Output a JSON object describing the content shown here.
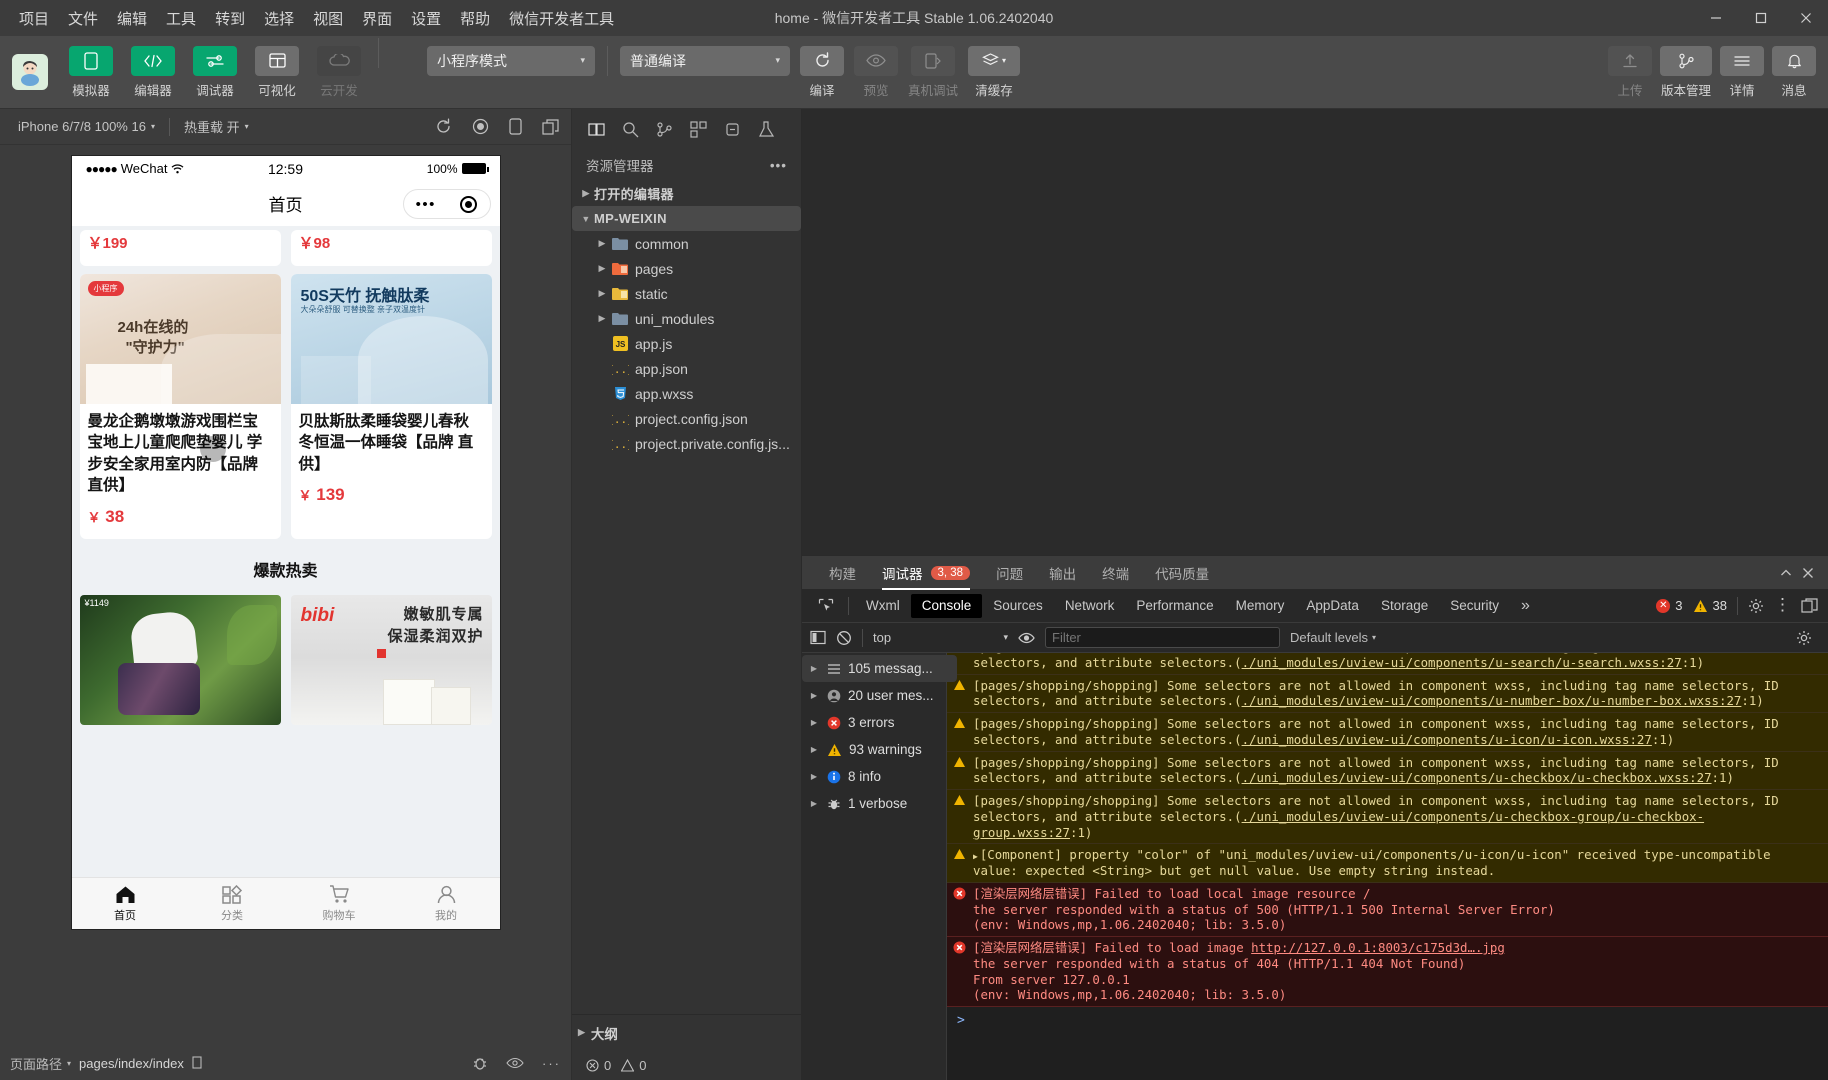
{
  "window": {
    "title": "home - 微信开发者工具 Stable 1.06.2402040",
    "controls": [
      "minimize",
      "maximize",
      "close"
    ]
  },
  "menubar": {
    "items": [
      "项目",
      "文件",
      "编辑",
      "工具",
      "转到",
      "选择",
      "视图",
      "界面",
      "设置",
      "帮助",
      "微信开发者工具"
    ]
  },
  "toolbar": {
    "avatar_icon": "user-avatar",
    "left_buttons": [
      {
        "label": "模拟器",
        "icon": "phone-icon",
        "style": "green"
      },
      {
        "label": "编辑器",
        "icon": "code-icon",
        "style": "green"
      },
      {
        "label": "调试器",
        "icon": "sliders-icon",
        "style": "green"
      },
      {
        "label": "可视化",
        "icon": "layout-icon",
        "style": "gray"
      },
      {
        "label": "云开发",
        "icon": "cloud-icon",
        "style": "dim"
      }
    ],
    "mode_select": {
      "value": "小程序模式",
      "caret": "▾"
    },
    "compile_select": {
      "value": "普通编译",
      "caret": "▾"
    },
    "mid_buttons": [
      {
        "label": "编译",
        "icon": "refresh-icon",
        "style": "gray"
      },
      {
        "label": "预览",
        "icon": "eye-icon",
        "style": "dim"
      },
      {
        "label": "真机调试",
        "icon": "phone-debug-icon",
        "style": "dim"
      },
      {
        "label": "清缓存",
        "icon": "layers-icon",
        "style": "gray",
        "caret": "▾"
      }
    ],
    "right_buttons": [
      {
        "label": "上传",
        "icon": "upload-icon",
        "style": "dim"
      },
      {
        "label": "版本管理",
        "icon": "branch-icon",
        "style": "gray"
      },
      {
        "label": "详情",
        "icon": "menu-icon",
        "style": "gray"
      },
      {
        "label": "消息",
        "icon": "bell-icon",
        "style": "gray"
      }
    ]
  },
  "simulator": {
    "device_select": "iPhone 6/7/8 100% 16",
    "hotreload_select": "热重载 开",
    "icons": [
      "refresh-icon",
      "record-icon",
      "rotate-device-icon",
      "detach-window-icon"
    ],
    "phone": {
      "status": {
        "carrier": "WeChat",
        "dots": "●●●●●",
        "wifi": "wifi-icon",
        "time": "12:59",
        "battery_text": "100%"
      },
      "nav_title": "首页",
      "capsule": {
        "more": "•••",
        "target": "target-icon"
      },
      "products": [
        {
          "title": "曼龙企鹅墩墩游戏围栏宝宝地上儿童爬爬垫婴儿 学步安全家用室内防【品牌直供】",
          "price": "38",
          "currency": "￥"
        },
        {
          "title": "贝肽斯肽柔睡袋婴儿春秋冬恒温一体睡袋【品牌 直供】",
          "price": "139",
          "currency": "￥"
        }
      ],
      "section_title": "爆款热卖",
      "banners": [
        {
          "name": "fashion-banner",
          "text": "¥1149"
        },
        {
          "name": "bibi-banner",
          "brand": "bibi",
          "line1": "嫩敏肌专属",
          "line2": "保湿柔润双护"
        }
      ],
      "tabbar": [
        {
          "label": "首页",
          "icon": "home-icon",
          "active": true
        },
        {
          "label": "分类",
          "icon": "grid-icon",
          "active": false
        },
        {
          "label": "购物车",
          "icon": "cart-icon",
          "active": false
        },
        {
          "label": "我的",
          "icon": "person-icon",
          "active": false
        }
      ]
    },
    "footer": {
      "path_label": "页面路径",
      "path_value": "pages/index/index",
      "copy_icon": "copy-icon",
      "right_icons": [
        "bug-icon",
        "eye-icon",
        "more-icon"
      ]
    }
  },
  "explorer": {
    "tab_icons": [
      "files-icon",
      "search-icon",
      "source-control-icon",
      "extensions-icon",
      "debug-icon",
      "test-icon"
    ],
    "header": "资源管理器",
    "header_more": "•••",
    "sections": [
      {
        "label": "打开的编辑器",
        "expanded": false
      },
      {
        "label": "MP-WEIXIN",
        "expanded": true
      }
    ],
    "tree": [
      {
        "label": "common",
        "type": "folder",
        "icon": "folder-blue"
      },
      {
        "label": "pages",
        "type": "folder",
        "icon": "folder-orange"
      },
      {
        "label": "static",
        "type": "folder",
        "icon": "folder-yellow"
      },
      {
        "label": "uni_modules",
        "type": "folder",
        "icon": "folder-blue"
      },
      {
        "label": "app.js",
        "type": "file",
        "icon": "js-icon"
      },
      {
        "label": "app.json",
        "type": "file",
        "icon": "json-icon"
      },
      {
        "label": "app.wxss",
        "type": "file",
        "icon": "css-icon"
      },
      {
        "label": "project.config.json",
        "type": "file",
        "icon": "json-icon"
      },
      {
        "label": "project.private.config.js...",
        "type": "file",
        "icon": "json-icon"
      }
    ],
    "outline": "大纲",
    "status": {
      "errors": "0",
      "warnings": "0"
    }
  },
  "devtools": {
    "panel_tabs": [
      {
        "label": "构建",
        "active": false
      },
      {
        "label": "调试器",
        "active": true,
        "badge": "3, 38"
      },
      {
        "label": "问题",
        "active": false
      },
      {
        "label": "输出",
        "active": false
      },
      {
        "label": "终端",
        "active": false
      },
      {
        "label": "代码质量",
        "active": false
      }
    ],
    "panel_actions": [
      "collapse-icon",
      "close-icon"
    ],
    "inspector_icon": "inspect-element-icon",
    "tabs": [
      {
        "label": "Wxml",
        "active": false
      },
      {
        "label": "Console",
        "active": true
      },
      {
        "label": "Sources",
        "active": false
      },
      {
        "label": "Network",
        "active": false
      },
      {
        "label": "Performance",
        "active": false
      },
      {
        "label": "Memory",
        "active": false
      },
      {
        "label": "AppData",
        "active": false
      },
      {
        "label": "Storage",
        "active": false
      },
      {
        "label": "Security",
        "active": false
      }
    ],
    "overflow": "»",
    "counts": {
      "errors": "3",
      "warnings": "38"
    },
    "tab_actions": [
      "settings-gear-icon",
      "more-vertical-icon",
      "dock-panel-icon"
    ],
    "console_bar": {
      "sidebar_toggle_icon": "toggle-sidebar-icon",
      "clear_icon": "clear-console-icon",
      "context": "top",
      "context_caret": "▾",
      "eye_icon": "live-expression-icon",
      "filter_value": "",
      "filter_placeholder": "Filter",
      "levels": "Default levels",
      "levels_caret": "▾",
      "settings_icon": "settings-gear-icon"
    },
    "sidebar": [
      {
        "label": "105 messag...",
        "icon": "list-icon",
        "selected": true
      },
      {
        "label": "20 user mes...",
        "icon": "user-icon",
        "selected": false
      },
      {
        "label": "3 errors",
        "icon": "error-icon",
        "selected": false
      },
      {
        "label": "93 warnings",
        "icon": "warning-icon",
        "selected": false
      },
      {
        "label": "8 info",
        "icon": "info-icon",
        "selected": false
      },
      {
        "label": "1 verbose",
        "icon": "verbose-icon",
        "selected": false
      }
    ],
    "messages": [
      {
        "level": "warning",
        "text": "[pages/index/search] Some selectors are not allowed in component wxss, including tag name selectors, ID selectors, and attribute selectors.(",
        "link": "./uni_modules/uview-ui/components/u-search/u-search.wxss:27",
        "tail": ":1)"
      },
      {
        "level": "warning",
        "text": "[pages/shopping/shopping] Some selectors are not allowed in component wxss, including tag name selectors, ID selectors, and attribute selectors.(",
        "link": "./uni_modules/uview-ui/components/u-number-box/u-number-box.wxss:27",
        "tail": ":1)"
      },
      {
        "level": "warning",
        "text": "[pages/shopping/shopping] Some selectors are not allowed in component wxss, including tag name selectors, ID selectors, and attribute selectors.(",
        "link": "./uni_modules/uview-ui/components/u-icon/u-icon.wxss:27",
        "tail": ":1)"
      },
      {
        "level": "warning",
        "text": "[pages/shopping/shopping] Some selectors are not allowed in component wxss, including tag name selectors, ID selectors, and attribute selectors.(",
        "link": "./uni_modules/uview-ui/components/u-checkbox/u-checkbox.wxss:27",
        "tail": ":1)"
      },
      {
        "level": "warning",
        "text": "[pages/shopping/shopping] Some selectors are not allowed in component wxss, including tag name selectors, ID selectors, and attribute selectors.(",
        "link": "./uni_modules/uview-ui/components/u-checkbox-group/u-checkbox-group.wxss:27",
        "tail": ":1)"
      },
      {
        "level": "warning",
        "expandable": true,
        "text": "[Component] property \"color\" of \"uni_modules/uview-ui/components/u-icon/u-icon\" received type-uncompatible value: expected <String> but get null value. Use empty string instead.",
        "link": "",
        "tail": ""
      },
      {
        "level": "error",
        "text": "[渲染层网络层错误] Failed to load local image resource /",
        "line2": "  the server responded with a status of 500 (HTTP/1.1 500 Internal Server Error)",
        "line3": "(env: Windows,mp,1.06.2402040; lib: 3.5.0)"
      },
      {
        "level": "error",
        "text": "[渲染层网络层错误] Failed to load image ",
        "link": "http://127.0.0.1:8003/c175d3d….jpg",
        "line2": "the server responded with a status of 404 (HTTP/1.1 404 Not Found)",
        "line3": "From server 127.0.0.1",
        "line4": "(env: Windows,mp,1.06.2402040; lib: 3.5.0)"
      }
    ],
    "prompt": ">"
  },
  "colors": {
    "accent_green": "#07a66f",
    "badge_red": "#e05a47",
    "warn_bg": "#332b00",
    "err_bg": "#2c0f0f",
    "price_red": "#e4393c"
  }
}
